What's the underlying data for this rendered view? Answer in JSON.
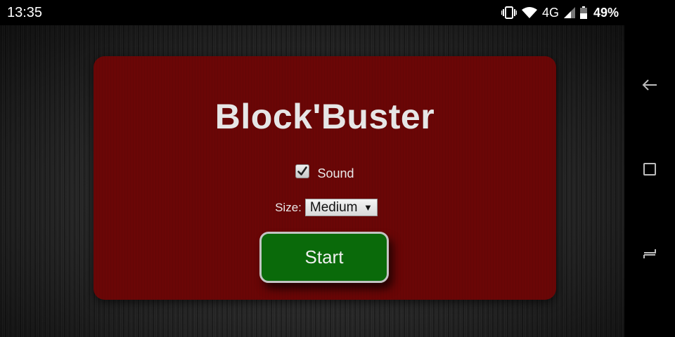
{
  "status_bar": {
    "time": "13:35",
    "network": "4G",
    "battery": "49%",
    "icons": [
      "vibrate-icon",
      "wifi-icon",
      "signal-icon",
      "battery-icon"
    ]
  },
  "app": {
    "title": "Block'Buster",
    "sound": {
      "label": "Sound",
      "checked": true
    },
    "size": {
      "label": "Size:",
      "selected": "Medium"
    },
    "start_label": "Start",
    "colors": {
      "panel": "#6a0606",
      "button": "#0a6a0a",
      "background": "#2a2a2a"
    }
  },
  "nav_bar": {
    "buttons": [
      "back-icon",
      "overview-icon",
      "recents-icon"
    ]
  }
}
